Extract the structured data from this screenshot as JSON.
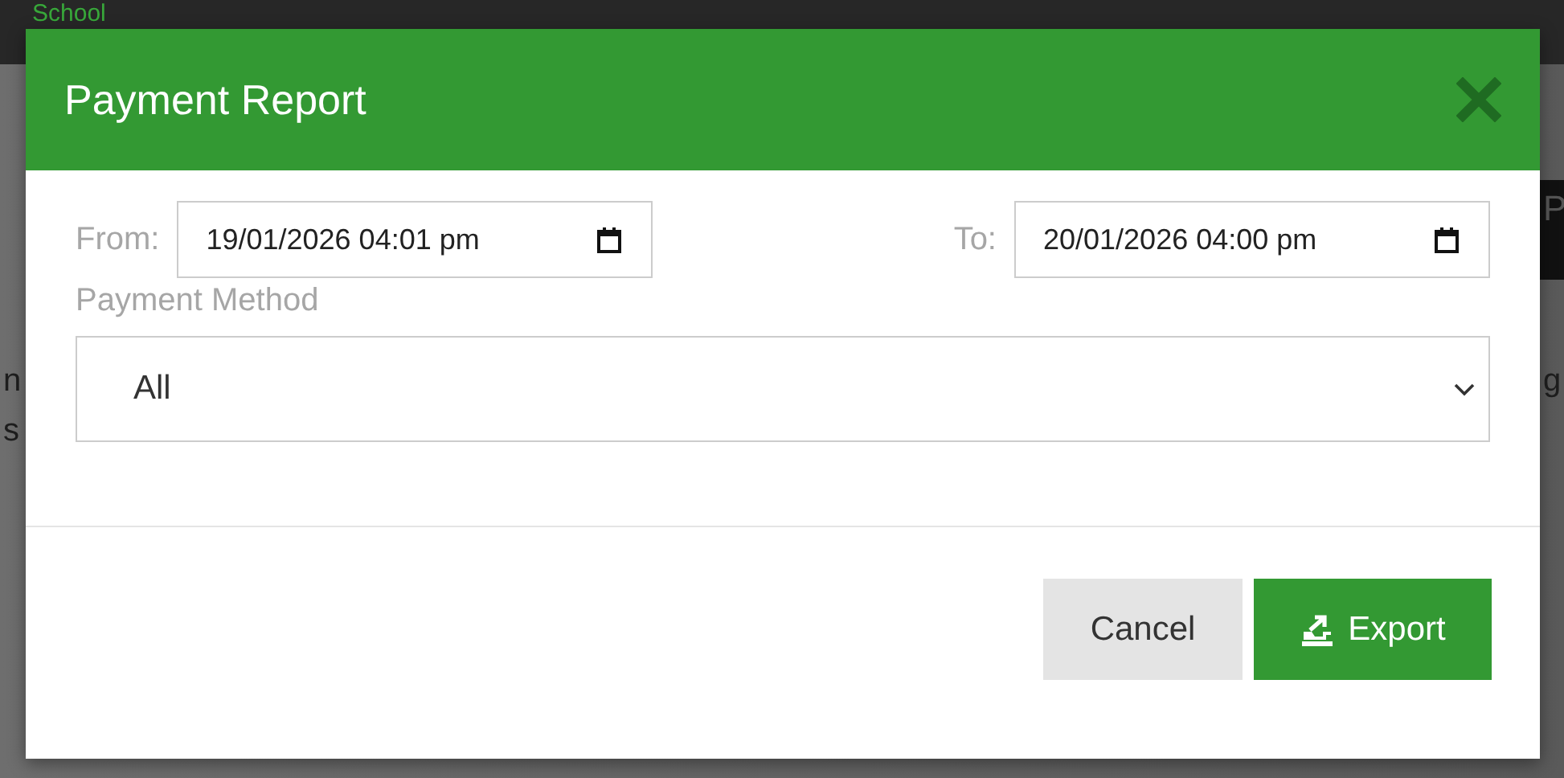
{
  "background": {
    "brand": "School",
    "fragments": [
      "P",
      "n",
      "g",
      "s"
    ]
  },
  "dialog": {
    "title": "Payment Report",
    "from": {
      "label": "From:",
      "value": "19/01/2026 04:01 pm"
    },
    "to": {
      "label": "To:",
      "value": "20/01/2026 04:00 pm"
    },
    "payment_method": {
      "label": "Payment Method",
      "value": "All"
    },
    "buttons": [
      {
        "label": "Cancel",
        "kind": "secondary"
      },
      {
        "label": "Export",
        "kind": "primary"
      }
    ]
  }
}
